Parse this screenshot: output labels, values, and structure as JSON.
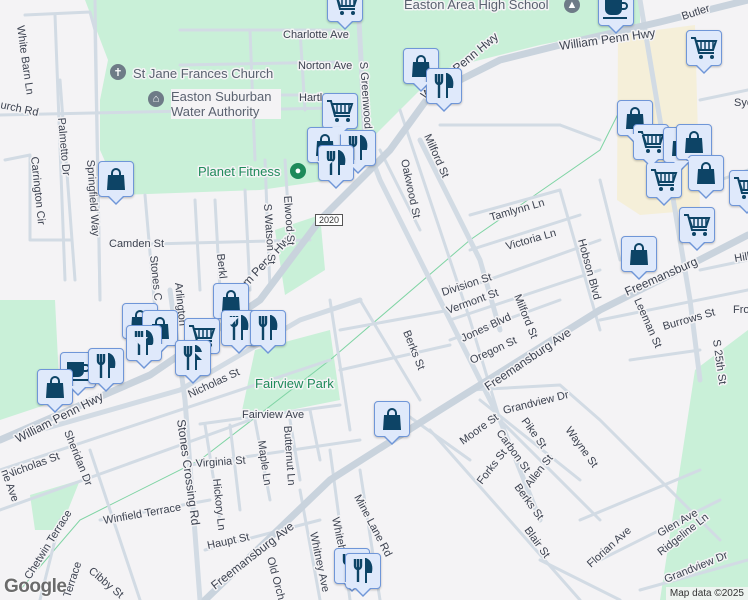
{
  "map": {
    "colors": {
      "background": "#f4f3f5",
      "park": "#c9f0d8",
      "commercial": "#f5efd9",
      "road": "#d2dbe4",
      "pin_fill": "#dfe9fb",
      "pin_border": "#6f96d8",
      "pin_icon": "#0d4466",
      "poi_green": "#1e8a5a",
      "poi_gray": "#6e7b87"
    },
    "route_shield": "2020",
    "pois": [
      {
        "name": "Easton Area High School",
        "icon": "school-icon"
      },
      {
        "name": "St Jane Frances Church",
        "icon": "church-icon"
      },
      {
        "name": "Easton Suburban Water Authority",
        "icon": "government-building-icon"
      },
      {
        "name": "Planet Fitness",
        "icon": "place-pin-icon"
      },
      {
        "name": "Fairview Park",
        "icon": "park"
      }
    ],
    "streets": {
      "william_penn_hwy": "William Penn Hwy",
      "freemansburg_ave": "Freemansburg Ave",
      "freemansburg_partial": "Freemansburg",
      "stones_crossing_rd": "Stones Crossing Rd",
      "s_greenwood": "S Greenwood",
      "charlotte_ave": "Charlotte Ave",
      "norton_ave": "Norton Ave",
      "hartley": "Hartl",
      "church_rd": "urch Rd",
      "white_barn_ln": "White Barn Ln",
      "palmetto_dr": "Palmetto Dr",
      "springfield_way": "Springfield Way",
      "carrington_cir": "Carrington Cir",
      "camden_st": "Camden St",
      "stones_c": "Stones C",
      "arlington": "Arlington",
      "berkl": "Berkl",
      "s_watson_st": "S Watson St",
      "elwood_st": "Elwood St",
      "milford_st": "Milford St",
      "oakwood_st": "Oakwood St",
      "tamlynn_ln": "Tamlynn Ln",
      "victoria_ln": "Victoria Ln",
      "hobson_blvd": "Hobson Blvd",
      "division_st": "Division St",
      "vermont_st": "Vermont St",
      "jones_blvd": "Jones Blvd",
      "oregon_st": "Oregon St",
      "milford_st_2": "Milford St",
      "berks_st": "Berks St",
      "leeman_st": "Leeman St",
      "burrows_st": "Burrows St",
      "s_25th_st": "S 25th St",
      "butler": "Butler",
      "syc": "Syc",
      "hill": "Hill",
      "fro": "Fro",
      "nicholas_st": "Nicholas St",
      "nicholas_st_2": "Nicholas St",
      "sheridan_dr": "Sheridan Dr",
      "fairview_ave": "Fairview Ave",
      "virginia_st": "Virginia St",
      "maple_ln": "Maple Ln",
      "butternut_ln": "Butternut Ln",
      "hickory_ln": "Hickory Ln",
      "winfield_terrace": "Winfield Terrace",
      "haupt_st": "Haupt St",
      "chetwin_terrace": "Chetwin Terrace",
      "terrace": "Terrace",
      "cibby_st": "Cibby St",
      "old_orchard": "Old Orcha",
      "whitney_ave": "Whitney Ave",
      "whiteh": "Whiteh",
      "mine_lane_rd": "Mine Lane Rd",
      "ne_ave": "ne Ave",
      "grandview_dr": "Grandview Dr",
      "moore_st": "Moore St",
      "pike_st": "Pike St",
      "carbon_st": "Carbon St",
      "wayne_st": "Wayne St",
      "forks_st": "Forks St",
      "allen_st": "Allen St",
      "berks_st_2": "Berks St",
      "blair_st": "Blair St",
      "florian_ave": "Florian Ave",
      "glen_ave": "Glen Ave",
      "ridgeline_ln": "Ridgeline Ln",
      "grandview_dr_2": "Grandview Dr"
    },
    "markers": [
      {
        "icon": "cart"
      },
      {
        "icon": "coffee"
      },
      {
        "icon": "bag"
      },
      {
        "icon": "restaurant"
      },
      {
        "icon": "cart"
      },
      {
        "icon": "cart"
      },
      {
        "icon": "bag"
      },
      {
        "icon": "restaurant"
      },
      {
        "icon": "restaurant"
      },
      {
        "icon": "bag"
      },
      {
        "icon": "bag"
      },
      {
        "icon": "cart"
      },
      {
        "icon": "bag"
      },
      {
        "icon": "bag"
      },
      {
        "icon": "cart"
      },
      {
        "icon": "bag"
      },
      {
        "icon": "cart"
      },
      {
        "icon": "cart"
      },
      {
        "icon": "bag"
      },
      {
        "icon": "bag"
      },
      {
        "icon": "bag"
      },
      {
        "icon": "bag"
      },
      {
        "icon": "restaurant"
      },
      {
        "icon": "cart"
      },
      {
        "icon": "restaurant"
      },
      {
        "icon": "restaurant"
      },
      {
        "icon": "restaurant"
      },
      {
        "icon": "coffee"
      },
      {
        "icon": "restaurant"
      },
      {
        "icon": "bag"
      },
      {
        "icon": "bag"
      },
      {
        "icon": "restaurant"
      },
      {
        "icon": "restaurant"
      }
    ],
    "attribution": "Map data ©2025",
    "logo": "Google"
  }
}
